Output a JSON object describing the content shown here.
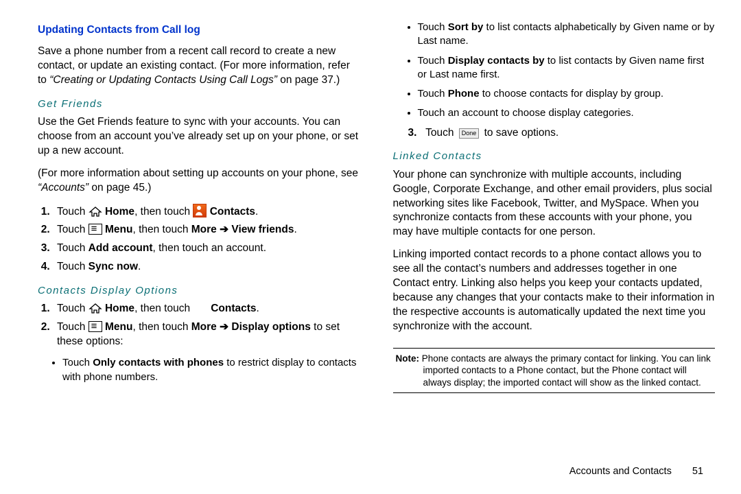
{
  "left": {
    "heading_blue": "Updating Contacts from Call log",
    "para1_a": "Save a phone number from a recent call record to create a new contact, or update an existing contact. (For more information, refer to ",
    "para1_ital": "“Creating or Updating Contacts Using Call Logs” ",
    "para1_b": "on page 37.)",
    "get_friends_h": "Get Friends",
    "gf_p1": "Use the Get Friends feature to sync with your accounts. You can choose from an account you’ve already set up on your phone, or set up a new account.",
    "gf_p2_a": "(For more information about setting up accounts on your phone, see ",
    "gf_p2_ital": "“Accounts” ",
    "gf_p2_b": "on page 45.)",
    "gf_step1_a": "Touch ",
    "gf_step1_home": "Home",
    "gf_step1_b": ", then touch ",
    "gf_step1_contacts": "Contacts",
    "gf_step2_a": "Touch ",
    "gf_step2_menu": "Menu",
    "gf_step2_b": ", then touch ",
    "gf_step2_more": "More",
    "gf_step2_view": "View friends",
    "gf_step3_a": "Touch ",
    "gf_step3_bold": "Add account",
    "gf_step3_b": ", then touch an account.",
    "gf_step4_a": "Touch ",
    "gf_step4_bold": "Sync now",
    "cdo_h": "Contacts Display Options",
    "cdo_step1_a": "Touch ",
    "cdo_step1_home": "Home",
    "cdo_step1_b": ", then touch ",
    "cdo_step1_contacts": "Contacts",
    "cdo_step2_a": "Touch ",
    "cdo_step2_menu": "Menu",
    "cdo_step2_b": ", then touch ",
    "cdo_step2_more": "More",
    "cdo_step2_disp": "Display options",
    "cdo_step2_c": " to set these options:",
    "cdo_b1_a": "Touch ",
    "cdo_b1_bold": "Only contacts with phones",
    "cdo_b1_b": " to restrict display to contacts with phone numbers."
  },
  "right": {
    "b1_a": "Touch ",
    "b1_bold": "Sort by",
    "b1_b": " to list contacts alphabetically by Given name or by Last name.",
    "b2_a": "Touch ",
    "b2_bold": "Display contacts by",
    "b2_b": " to list contacts by Given name first or Last name first.",
    "b3_a": "Touch ",
    "b3_bold": "Phone",
    "b3_b": " to choose contacts for display by group.",
    "b4": "Touch an account to choose display categories.",
    "step3_a": "Touch ",
    "step3_done": "Done",
    "step3_b": " to save options.",
    "linked_h": "Linked Contacts",
    "lc_p1": "Your phone can synchronize with multiple accounts, including Google, Corporate Exchange, and other email providers, plus social networking sites like Facebook, Twitter, and MySpace. When you synchronize contacts from these accounts with your phone, you may have multiple contacts for one person.",
    "lc_p2": "Linking imported contact records to a phone contact allows you to see all the contact’s numbers and addresses together in one Contact entry. Linking also helps you keep your contacts updated, because any changes that your contacts make to their information in the respective accounts is automatically updated the next time you synchronize with the account.",
    "note_lead": "Note: ",
    "note_body": "Phone contacts are always the primary contact for linking. You can link imported contacts to a Phone contact, but the Phone contact will always display; the imported contact will show as the linked contact."
  },
  "footer": {
    "section": "Accounts and Contacts",
    "page": "51"
  }
}
